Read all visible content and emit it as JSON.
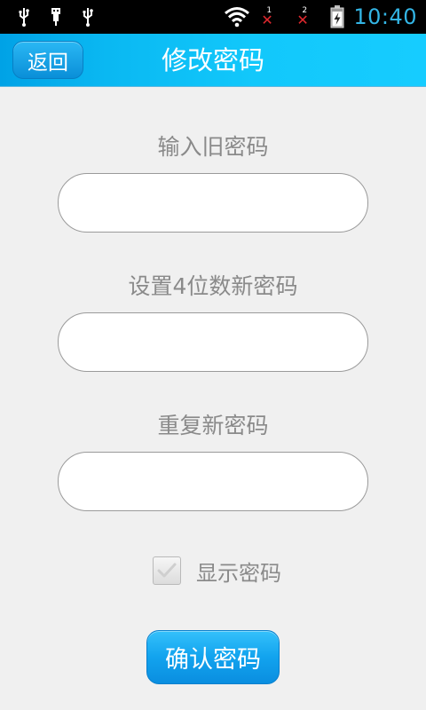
{
  "status_bar": {
    "time": "10:40",
    "sim1_label": "1",
    "sim2_label": "2",
    "icons": [
      "usb-icon",
      "usb-debug-icon",
      "usb-icon",
      "wifi-icon",
      "signal-no-sim-icon",
      "signal-no-sim-icon",
      "battery-charging-icon"
    ]
  },
  "title_bar": {
    "back_label": "返回",
    "title": "修改密码",
    "gradient": [
      "#00a2e6",
      "#16ccff"
    ]
  },
  "form": {
    "old_password_label": "输入旧密码",
    "old_password_value": "",
    "new_password_label": "设置4位数新密码",
    "new_password_value": "",
    "repeat_password_label": "重复新密码",
    "repeat_password_value": "",
    "show_password_label": "显示密码",
    "show_password_checked": true,
    "confirm_label": "确认密码"
  },
  "colors": {
    "accent": "#12a3ee",
    "clock": "#33b5e5",
    "label": "#8a8a8a",
    "background": "#f0f0f0"
  }
}
